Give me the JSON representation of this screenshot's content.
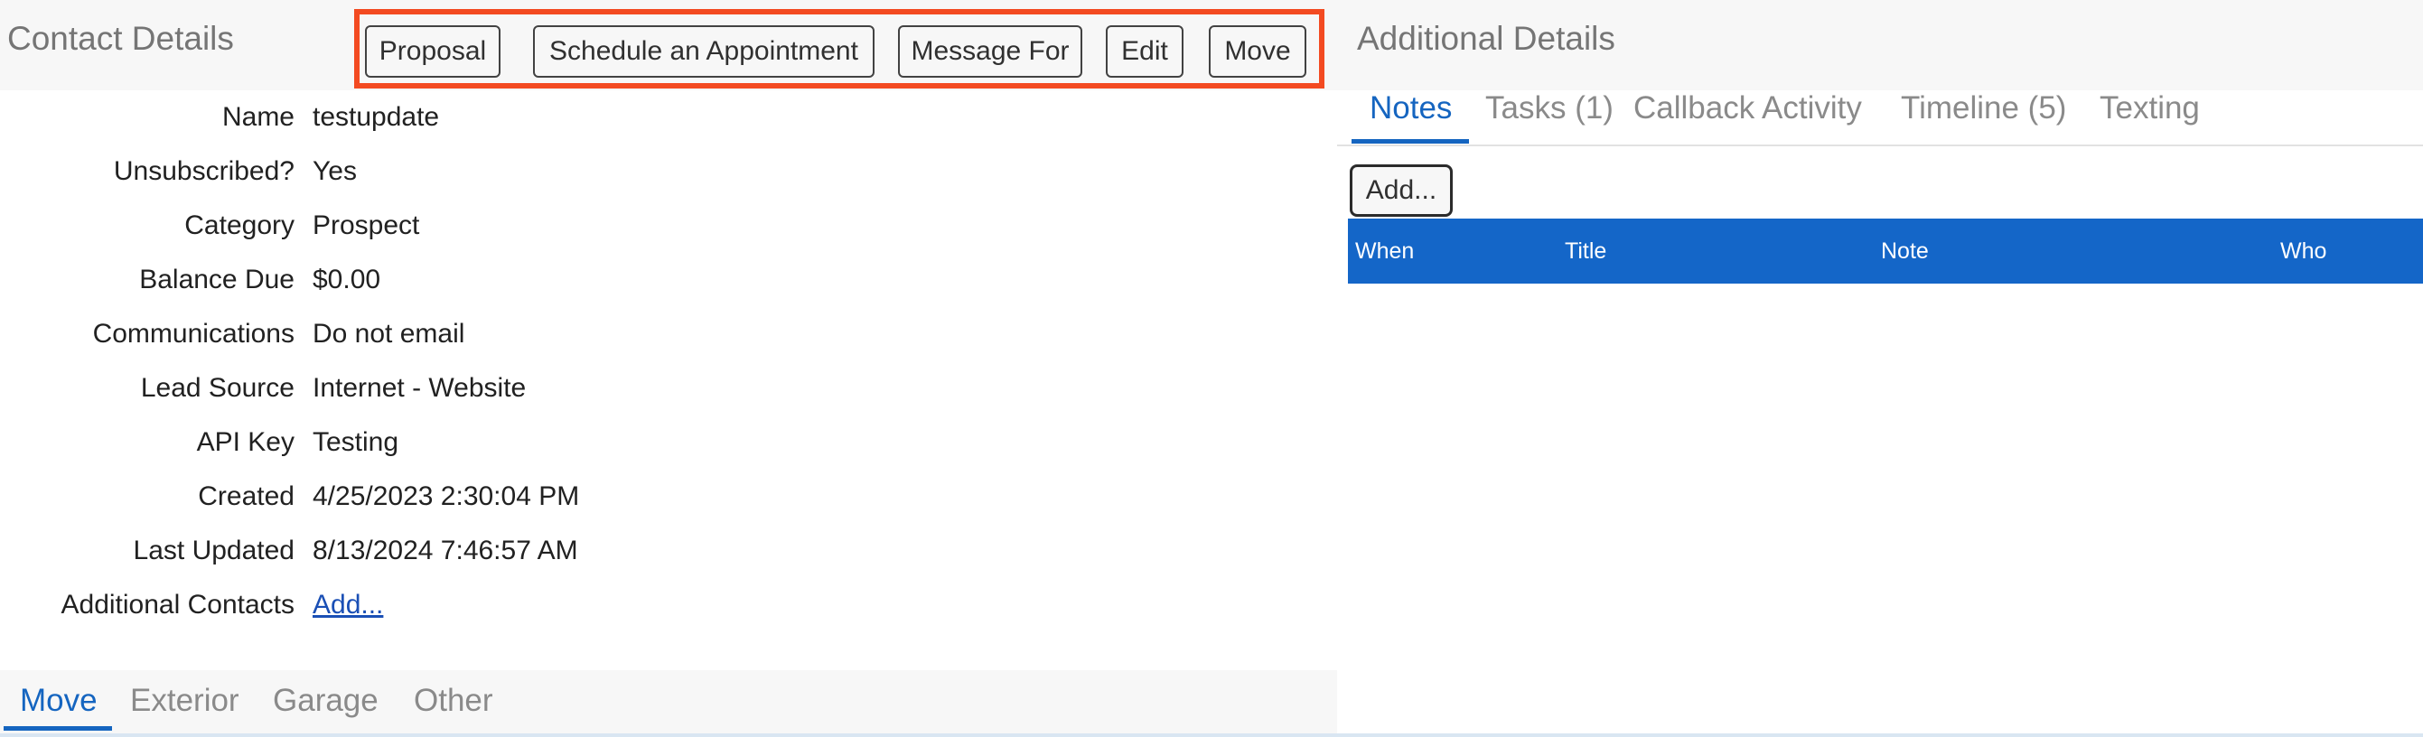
{
  "contact_details": {
    "title": "Contact Details",
    "toolbar": {
      "proposal": "Proposal",
      "schedule": "Schedule an Appointment",
      "message_for": "Message For",
      "edit": "Edit",
      "move": "Move"
    },
    "fields": [
      {
        "label": "Name",
        "value": "testupdate"
      },
      {
        "label": "Unsubscribed?",
        "value": "Yes"
      },
      {
        "label": "Category",
        "value": "Prospect"
      },
      {
        "label": "Balance Due",
        "value": "$0.00"
      },
      {
        "label": "Communications",
        "value": "Do not email"
      },
      {
        "label": "Lead Source",
        "value": "Internet - Website"
      },
      {
        "label": "API Key",
        "value": "Testing"
      },
      {
        "label": "Created",
        "value": "4/25/2023 2:30:04 PM"
      },
      {
        "label": "Last Updated",
        "value": "8/13/2024 7:46:57 AM"
      },
      {
        "label": "Additional Contacts",
        "value": "Add..."
      }
    ],
    "bottom_tabs": [
      "Move",
      "Exterior",
      "Garage",
      "Other"
    ],
    "active_bottom_tab": "Move"
  },
  "additional_details": {
    "title": "Additional Details",
    "tabs": [
      "Notes",
      "Tasks (1)",
      "Callback Activity",
      "Timeline (5)",
      "Texting"
    ],
    "active_tab": "Notes",
    "add_button": "Add...",
    "table_columns": [
      "When",
      "Title",
      "Note",
      "Who"
    ]
  },
  "colors": {
    "highlight_border": "#f34a21",
    "accent": "#1565c0",
    "table_header": "#1466c8"
  }
}
